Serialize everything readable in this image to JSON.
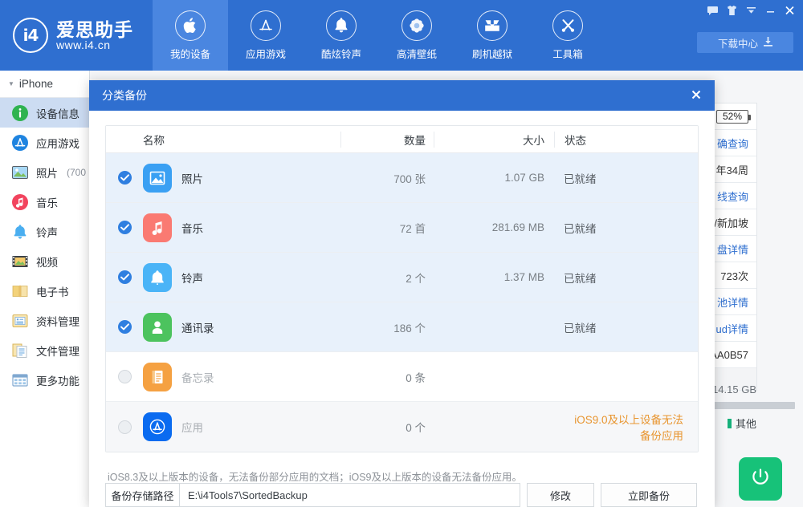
{
  "header": {
    "brand": {
      "logo_text": "i4",
      "name": "爱思助手",
      "url": "www.i4.cn"
    },
    "nav": [
      {
        "label": "我的设备",
        "icon": "apple-icon",
        "active": true
      },
      {
        "label": "应用游戏",
        "icon": "appstore-icon",
        "active": false
      },
      {
        "label": "酷炫铃声",
        "icon": "bell-icon",
        "active": false
      },
      {
        "label": "高清壁纸",
        "icon": "flower-icon",
        "active": false
      },
      {
        "label": "刷机越狱",
        "icon": "box-download-icon",
        "active": false
      },
      {
        "label": "工具箱",
        "icon": "tools-icon",
        "active": false
      }
    ],
    "window_controls": [
      {
        "name": "feedback-icon"
      },
      {
        "name": "skin-icon"
      },
      {
        "name": "menu-dropdown-icon"
      },
      {
        "name": "minimize-icon"
      },
      {
        "name": "close-icon"
      }
    ],
    "download_center": {
      "label": "下载中心",
      "icon": "download-icon"
    }
  },
  "sidebar": {
    "device": "iPhone",
    "items": [
      {
        "label": "设备信息",
        "count": "",
        "icon": "info-icon",
        "active": true
      },
      {
        "label": "应用游戏",
        "count": "",
        "icon": "appstore-icon",
        "active": false
      },
      {
        "label": "照片",
        "count": "(700",
        "icon": "photo-icon",
        "active": false
      },
      {
        "label": "音乐",
        "count": "",
        "icon": "music-icon",
        "active": false
      },
      {
        "label": "铃声",
        "count": "",
        "icon": "bell-icon",
        "active": false
      },
      {
        "label": "视频",
        "count": "",
        "icon": "video-icon",
        "active": false
      },
      {
        "label": "电子书",
        "count": "",
        "icon": "book-icon",
        "active": false
      },
      {
        "label": "资料管理",
        "count": "",
        "icon": "data-folder-icon",
        "active": false
      },
      {
        "label": "文件管理",
        "count": "",
        "icon": "file-manager-icon",
        "active": false
      },
      {
        "label": "更多功能",
        "count": "",
        "icon": "grid-icon",
        "active": false
      }
    ]
  },
  "background_panel": {
    "info_rows": [
      {
        "text": "52%",
        "type": "battery"
      },
      {
        "text": "确查询",
        "type": "link"
      },
      {
        "text": "年34周",
        "type": "plain"
      },
      {
        "text": "线查询",
        "type": "link"
      },
      {
        "text": "/新加坡",
        "type": "plain"
      },
      {
        "text": "盘详情",
        "type": "link"
      },
      {
        "text": "723次",
        "type": "plain"
      },
      {
        "text": "池详情",
        "type": "link"
      },
      {
        "text": "ud详情",
        "type": "link"
      },
      {
        "text": "AA0B57",
        "type": "plain"
      }
    ],
    "storage_free": "14.15 GB",
    "legend_other": "其他",
    "power_button": "power-icon"
  },
  "modal": {
    "title": "分类备份",
    "close_label": "✕",
    "table": {
      "columns": [
        "名称",
        "数量",
        "大小",
        "状态"
      ],
      "rows": [
        {
          "checked": true,
          "icon": "photos-icon",
          "icon_color": "#3aa0f3",
          "name": "照片",
          "qty": "700 张",
          "size": "1.07 GB",
          "status": "已就绪",
          "dim": false,
          "warn": false,
          "bg": "sel"
        },
        {
          "checked": true,
          "icon": "music-icon",
          "icon_color": "#fa7a72",
          "name": "音乐",
          "qty": "72 首",
          "size": "281.69 MB",
          "status": "已就绪",
          "dim": false,
          "warn": false,
          "bg": "sel"
        },
        {
          "checked": true,
          "icon": "ringtone-icon",
          "icon_color": "#4ab4f7",
          "name": "铃声",
          "qty": "2 个",
          "size": "1.37 MB",
          "status": "已就绪",
          "dim": false,
          "warn": false,
          "bg": "sel"
        },
        {
          "checked": true,
          "icon": "contacts-icon",
          "icon_color": "#4cc35e",
          "name": "通讯录",
          "qty": "186 个",
          "size": "",
          "status": "已就绪",
          "dim": false,
          "warn": false,
          "bg": "sel"
        },
        {
          "checked": false,
          "icon": "notes-icon",
          "icon_color": "#f5a142",
          "name": "备忘录",
          "qty": "0 条",
          "size": "",
          "status": "",
          "dim": true,
          "warn": false,
          "bg": "plain"
        },
        {
          "checked": false,
          "icon": "appstore-icon",
          "icon_color": "#0a6bf0",
          "name": "应用",
          "qty": "0 个",
          "size": "",
          "status": "iOS9.0及以上设备无法备份应用",
          "dim": true,
          "warn": true,
          "bg": "odd"
        }
      ]
    },
    "note": "iOS8.3及以上版本的设备，无法备份部分应用的文档；iOS9及以上版本的设备无法备份应用。",
    "footer": {
      "path_label": "备份存储路径",
      "path_value": "E:\\i4Tools7\\SortedBackup",
      "modify_label": "修改",
      "backup_label": "立即备份"
    }
  },
  "colors": {
    "header_blue": "#2f6fd0",
    "nav_active": "#4a86e0",
    "row_selected": "#e8f1fb",
    "warn_orange": "#e8952f",
    "power_green": "#17c279",
    "link_blue": "#2f6fd0"
  }
}
